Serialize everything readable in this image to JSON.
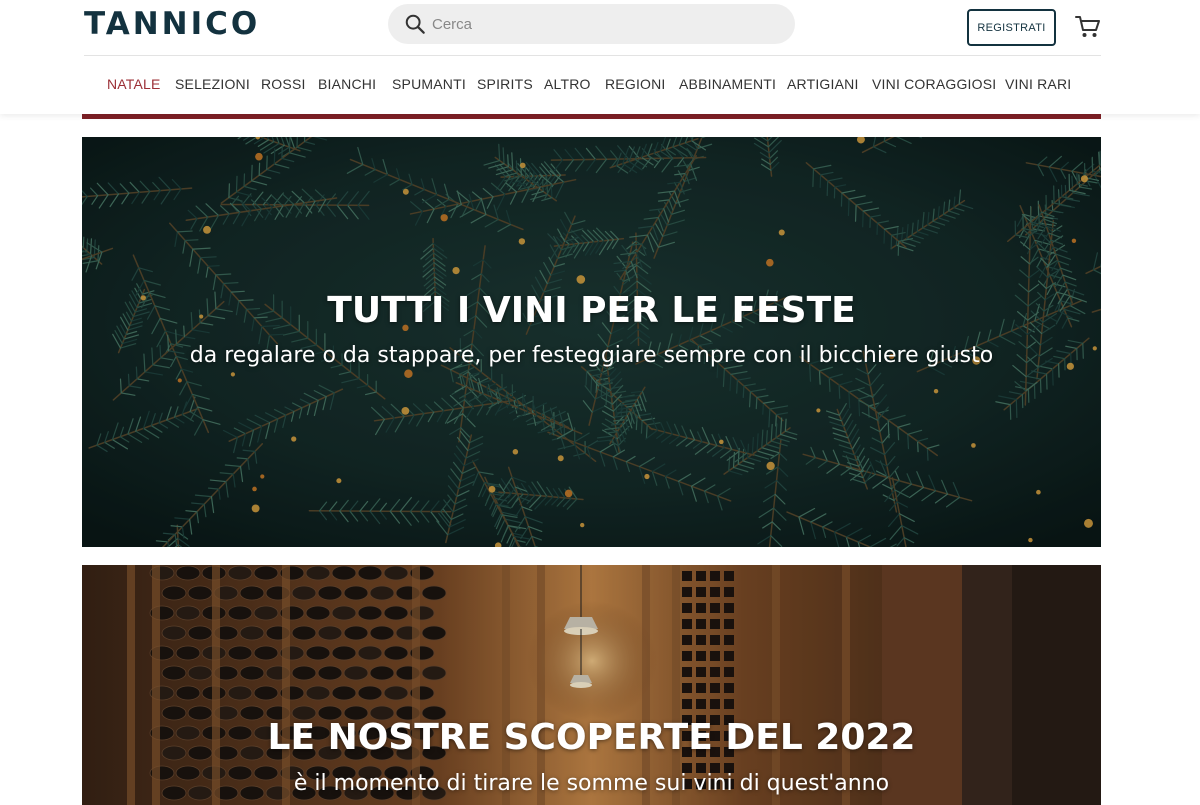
{
  "brand": {
    "logo_text": "TANNICO",
    "color": "#13323f",
    "accent": "#9c2f36"
  },
  "search": {
    "placeholder": "Cerca",
    "value": "",
    "icon": "search-icon"
  },
  "header": {
    "register_label": "REGISTRATI",
    "cart_icon": "cart-icon"
  },
  "nav": {
    "items": [
      {
        "label": "NATALE",
        "active": true
      },
      {
        "label": "SELEZIONI",
        "active": false
      },
      {
        "label": "ROSSI",
        "active": false
      },
      {
        "label": "BIANCHI",
        "active": false
      },
      {
        "label": "SPUMANTI",
        "active": false
      },
      {
        "label": "SPIRITS",
        "active": false
      },
      {
        "label": "ALTRO",
        "active": false
      },
      {
        "label": "REGIONI",
        "active": false
      },
      {
        "label": "ABBINAMENTI",
        "active": false
      },
      {
        "label": "ARTIGIANI",
        "active": false
      },
      {
        "label": "VINI CORAGGIOSI",
        "active": false
      },
      {
        "label": "VINI RARI",
        "active": false
      }
    ]
  },
  "banners": [
    {
      "title": "TUTTI I VINI PER LE FESTE",
      "subtitle": "da regalare o da stappare, per festeggiare sempre con il bicchiere giusto"
    },
    {
      "title": "LE NOSTRE SCOPERTE DEL 2022",
      "subtitle": "è il momento di tirare le somme sui vini di quest'anno"
    }
  ]
}
